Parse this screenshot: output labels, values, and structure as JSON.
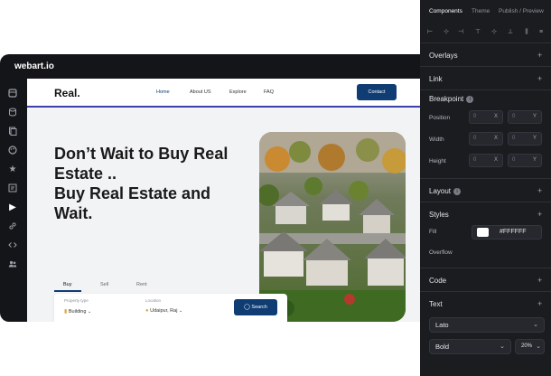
{
  "editor": {
    "title": "webart.io",
    "rail_icons": [
      "layers-icon",
      "database-icon",
      "pages-icon",
      "palette-icon",
      "star-icon",
      "text-icon",
      "play-icon",
      "link-icon",
      "code-icon",
      "users-icon"
    ]
  },
  "site": {
    "logo": "Real.",
    "nav": [
      "Home",
      "About US",
      "Explore",
      "FAQ"
    ],
    "contact_label": "Contact",
    "hero_lines": [
      "Don’t Wait to Buy Real",
      "Estate ..",
      "Buy Real Estate and",
      "Wait."
    ],
    "tabs": [
      "Buy",
      "Sell",
      "Rent"
    ],
    "search": {
      "type_label": "Property type",
      "type_value": "Building",
      "location_label": "Location",
      "location_value": "Udaipur, Raj",
      "button_label": "Search"
    }
  },
  "panel": {
    "tabs": [
      "Components",
      "Theme",
      "Publish / Preview"
    ],
    "overlays": "Overlays",
    "link": "Link",
    "breakpoint": "Breakpoint",
    "position_label": "Position",
    "width_label": "Width",
    "height_label": "Height",
    "zero": "0",
    "axis_x": "X",
    "axis_y": "Y",
    "layout": "Layout",
    "styles": "Styles",
    "fill_label": "Fill",
    "fill_value": "#FFFFFF",
    "overflow_label": "Overflow",
    "code": "Code",
    "text": "Text",
    "font_family": "Lato",
    "font_weight": "Bold",
    "font_size": "20%"
  },
  "colors": {
    "accent": "#0f3c73",
    "editor_bg": "#141518",
    "panel_bg": "#1b1c20",
    "canvas_bg": "#f2f3f5"
  }
}
